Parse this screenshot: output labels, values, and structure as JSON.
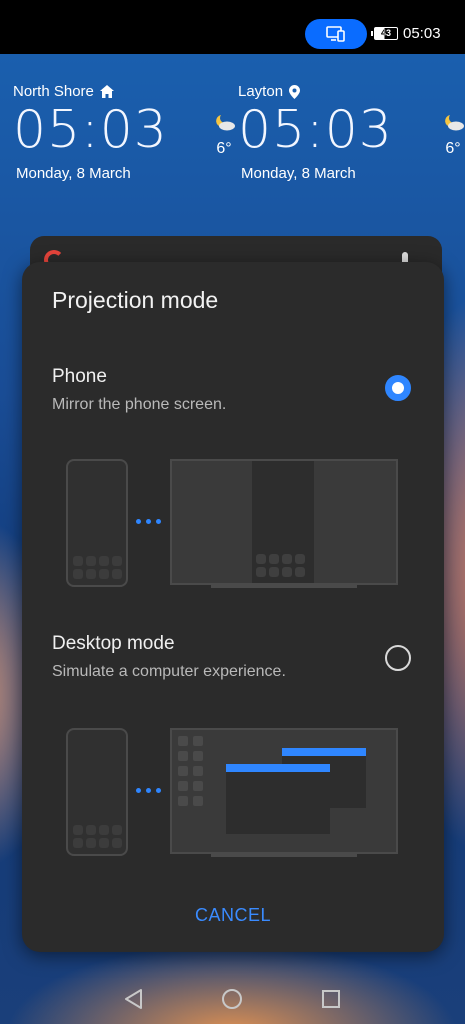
{
  "status_bar": {
    "time": "05:03",
    "battery": "43",
    "cast_icon": "screen-cast-icon",
    "accent": "#0a6cff"
  },
  "clocks": [
    {
      "city": "North Shore",
      "icon": "home-icon",
      "time": "05:03",
      "date": "Monday, 8 March",
      "temp": "6°",
      "weather_icon": "partly-cloudy-night-icon"
    },
    {
      "city": "Layton",
      "icon": "location-pin-icon",
      "time": "05:03",
      "date": "Monday, 8 March",
      "temp": "6°",
      "weather_icon": "partly-cloudy-night-icon"
    }
  ],
  "dialog": {
    "title": "Projection mode",
    "options": [
      {
        "title": "Phone",
        "subtitle": "Mirror the phone screen.",
        "selected": true
      },
      {
        "title": "Desktop mode",
        "subtitle": "Simulate a computer experience.",
        "selected": false
      }
    ],
    "cancel_label": "CANCEL",
    "accent": "#2f86ff",
    "background": "#2b2b2b"
  },
  "nav_bar": {
    "back_icon": "back-triangle-icon",
    "home_icon": "home-circle-icon",
    "recents_icon": "recents-square-icon"
  }
}
